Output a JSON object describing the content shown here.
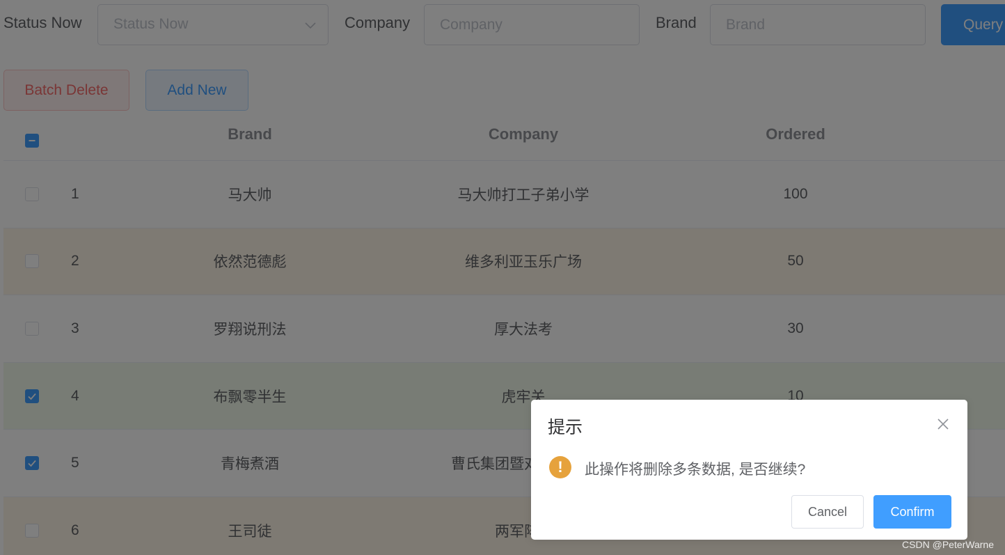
{
  "search_form": {
    "status_label": "Status Now",
    "status_placeholder": "Status Now",
    "company_label": "Company",
    "company_placeholder": "Company",
    "brand_label": "Brand",
    "brand_placeholder": "Brand",
    "query_label": "Query"
  },
  "actions": {
    "batch_delete_label": "Batch Delete",
    "add_new_label": "Add New"
  },
  "table": {
    "columns": [
      "Brand",
      "Company",
      "Ordered"
    ],
    "rows": [
      {
        "index": "1",
        "brand": "马大帅",
        "company": "马大帅打工子弟小学",
        "ordered": "100",
        "checked": false
      },
      {
        "index": "2",
        "brand": "依然范德彪",
        "company": "维多利亚玉乐广场",
        "ordered": "50",
        "checked": false
      },
      {
        "index": "3",
        "brand": "罗翔说刑法",
        "company": "厚大法考",
        "ordered": "30",
        "checked": false
      },
      {
        "index": "4",
        "brand": "布飘零半生",
        "company": "虎牢关",
        "ordered": "10",
        "checked": true
      },
      {
        "index": "5",
        "brand": "青梅煮酒",
        "company": "曹氏集团暨对",
        "ordered": "",
        "checked": true
      },
      {
        "index": "6",
        "brand": "王司徒",
        "company": "两军阵",
        "ordered": "",
        "checked": false
      }
    ]
  },
  "dialog": {
    "title": "提示",
    "message": "此操作将删除多条数据, 是否继续?",
    "cancel_label": "Cancel",
    "confirm_label": "Confirm",
    "warning_icon_glyph": "!"
  },
  "watermark": "CSDN @PeterWarne",
  "colors": {
    "primary": "#409eff",
    "danger": "#f56c6c",
    "warning": "#e6a23c",
    "row_warning_bg": "#fdf5e6",
    "row_success_bg": "#f0f9eb"
  },
  "icons": {
    "select_arrow": "chevron-down-icon",
    "dialog_close": "close-icon",
    "dialog_status": "warning-icon",
    "header_checkbox": "indeterminate-checkbox-icon",
    "row_checkbox": "check-icon"
  }
}
